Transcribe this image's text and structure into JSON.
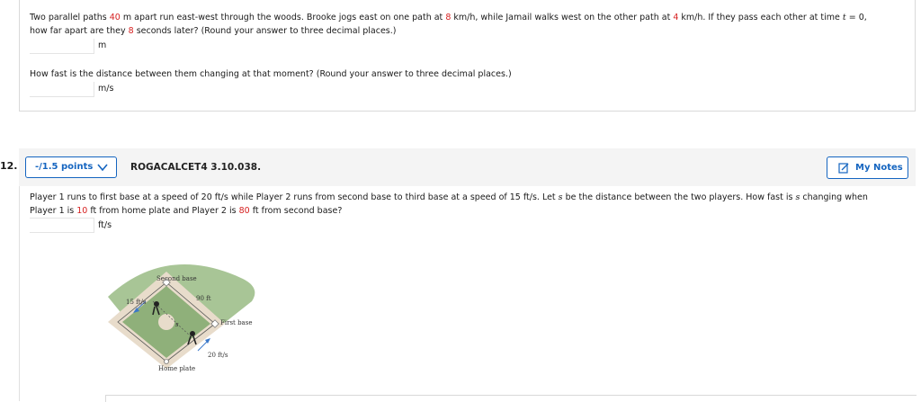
{
  "prev_question": {
    "text_a": "Two parallel paths ",
    "dist": "40",
    "text_b": " m apart run east-west through the woods. Brooke jogs east on one path at ",
    "speed1": "8",
    "text_c": " km/h, while Jamail walks west on the other path at ",
    "speed2": "4",
    "text_d": " km/h. If they pass each other at time ",
    "t_var": "t",
    "text_e": " = 0,",
    "line2_a": "how far apart are they ",
    "seconds": "8",
    "line2_b": " seconds later? (Round your answer to three decimal places.)",
    "unit1": "m",
    "part2": "How fast is the distance between them changing at that moment? (Round your answer to three decimal places.)",
    "unit2": "m/s"
  },
  "question": {
    "number": "12.",
    "points_label": "-/1.5 points",
    "code": "ROGACALCET4 3.10.038.",
    "notes_label": "My Notes",
    "line1_a": "Player 1 runs to first base at a speed of 20 ft/s while Player 2 runs from second base to third base at a speed of 15 ft/s. Let ",
    "s1": "s",
    "line1_b": " be the distance between the two players. How fast is ",
    "s2": "s",
    "line1_c": " changing when",
    "line2_a": "Player 1 is ",
    "p1_dist": "10",
    "line2_b": " ft from home plate and Player 2 is ",
    "p2_dist": "80",
    "line2_c": " ft from second base?",
    "unit": "ft/s"
  },
  "figure": {
    "second_base": "Second base",
    "first_base": "First base",
    "home_plate": "Home plate",
    "speed_p2": "15 ft/s",
    "speed_p1": "20 ft/s",
    "side": "90 ft",
    "s_label": "s"
  },
  "colors": {
    "highlight": "#d61f1f",
    "accent": "#1565c0",
    "grass": "#9fbf8a",
    "dirt": "#e8dccb"
  }
}
